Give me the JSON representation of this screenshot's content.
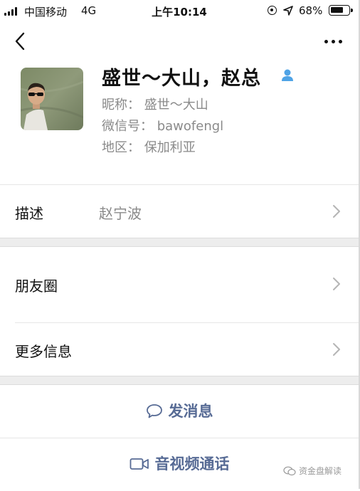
{
  "status_bar": {
    "carrier": "中国移动",
    "network": "4G",
    "time": "上午10:14",
    "battery_percent": "68%",
    "battery_level": 0.68
  },
  "nav": {
    "back_icon": "chevron-left-icon",
    "more_icon": "ellipsis-icon"
  },
  "profile": {
    "display_name": "盛世～大山，赵总",
    "nickname": "昵称：  盛世～大山",
    "wechat_id": "微信号：  bawofengl",
    "region": "地区：  保加利亚",
    "badge_icon": "person-icon"
  },
  "rows": {
    "description_label": "描述",
    "description_value": "赵宁波",
    "moments_label": "朋友圈",
    "more_info_label": "更多信息"
  },
  "actions": {
    "message_label": "发消息",
    "call_label": "音视频通话"
  },
  "watermark": "资金盘解读",
  "colors": {
    "link": "#576b95",
    "secondary_text": "#8a8a8a",
    "gap_background": "#ededed"
  }
}
